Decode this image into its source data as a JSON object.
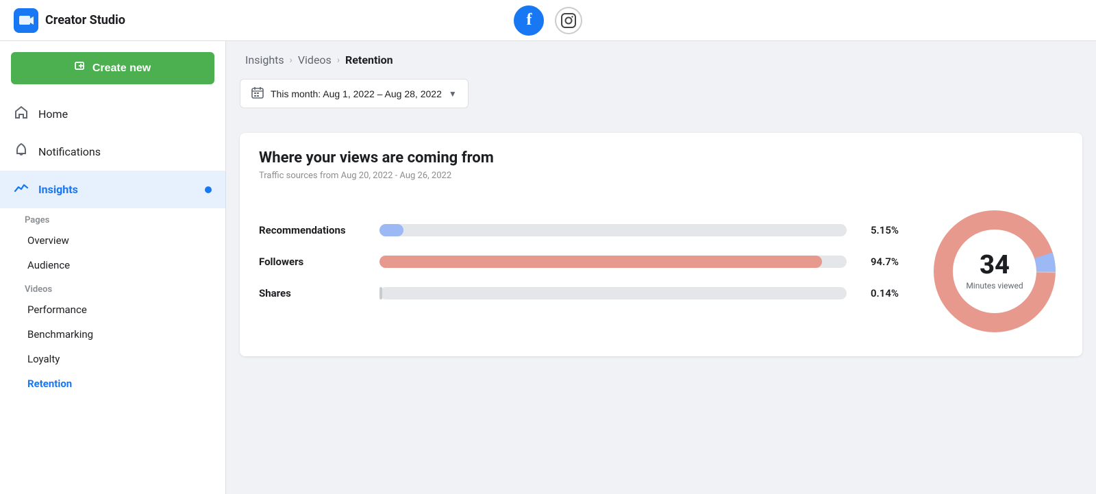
{
  "header": {
    "title": "Creator Studio",
    "facebook_icon": "f",
    "instagram_icon": "📷"
  },
  "sidebar": {
    "create_new_label": "Create new",
    "nav_items": [
      {
        "id": "home",
        "label": "Home",
        "icon": "🏠"
      },
      {
        "id": "notifications",
        "label": "Notifications",
        "icon": "🔔"
      },
      {
        "id": "insights",
        "label": "Insights",
        "icon": "📈",
        "active": true
      }
    ],
    "pages_label": "Pages",
    "pages_sub": [
      {
        "id": "overview",
        "label": "Overview"
      },
      {
        "id": "audience",
        "label": "Audience"
      }
    ],
    "videos_label": "Videos",
    "videos_sub": [
      {
        "id": "performance",
        "label": "Performance"
      },
      {
        "id": "benchmarking",
        "label": "Benchmarking"
      },
      {
        "id": "loyalty",
        "label": "Loyalty"
      },
      {
        "id": "retention",
        "label": "Retention",
        "active": true
      }
    ]
  },
  "breadcrumb": {
    "insights": "Insights",
    "videos": "Videos",
    "current": "Retention"
  },
  "date_picker": {
    "label": "This month: Aug 1, 2022 – Aug 28, 2022"
  },
  "chart": {
    "title": "Where your views are coming from",
    "subtitle": "Traffic sources from Aug 20, 2022 - Aug 26, 2022",
    "bars": [
      {
        "id": "recommendations",
        "label": "Recommendations",
        "pct": "5.15%",
        "fill_class": "recommendations"
      },
      {
        "id": "followers",
        "label": "Followers",
        "pct": "94.7%",
        "fill_class": "followers"
      },
      {
        "id": "shares",
        "label": "Shares",
        "pct": "0.14%",
        "fill_class": "shares"
      }
    ]
  },
  "donut": {
    "number": "34",
    "label": "Minutes viewed",
    "followers_pct": 94.7,
    "recommendations_pct": 5.15,
    "shares_pct": 0.14
  }
}
